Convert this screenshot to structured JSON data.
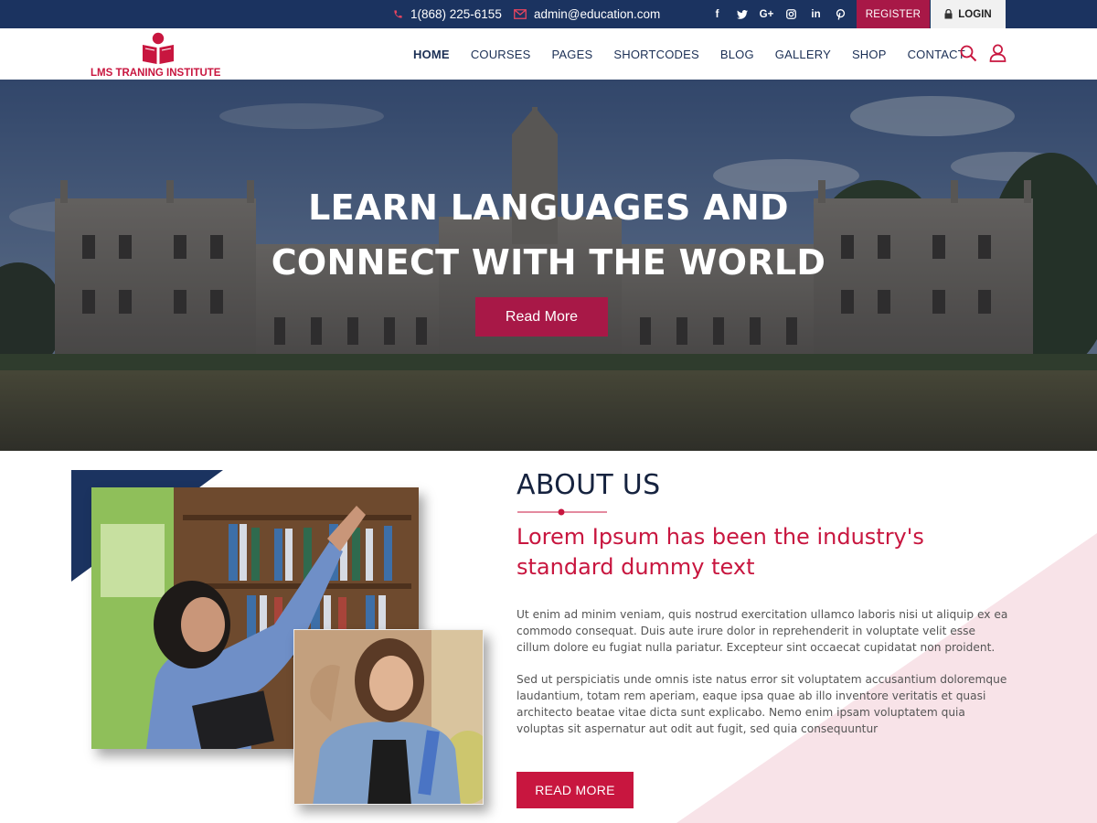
{
  "topbar": {
    "phone": "1(868) 225-6155",
    "email": "admin@education.com",
    "social": [
      {
        "icon": "facebook-icon",
        "glyph": "f"
      },
      {
        "icon": "twitter-icon",
        "glyph": "t"
      },
      {
        "icon": "google-plus-icon",
        "glyph": "G+"
      },
      {
        "icon": "instagram-icon",
        "glyph": "ig"
      },
      {
        "icon": "linkedin-icon",
        "glyph": "in"
      },
      {
        "icon": "pinterest-icon",
        "glyph": "p"
      }
    ],
    "register_label": "REGISTER",
    "login_label": "LOGIN"
  },
  "header": {
    "logo_text": "LMS TRANING INSTITUTE",
    "nav": [
      "HOME",
      "COURSES",
      "PAGES",
      "SHORTCODES",
      "BLOG",
      "GALLERY",
      "SHOP",
      "CONTACT"
    ],
    "active_nav": "HOME"
  },
  "hero": {
    "title_line1": "LEARN LANGUAGES AND",
    "title_line2": "CONNECT WITH THE WORLD",
    "button_label": "Read More"
  },
  "about": {
    "title": "ABOUT US",
    "subtitle": "Lorem Ipsum has been the industry's standard dummy text",
    "paragraph1": "Ut enim ad minim veniam, quis nostrud exercitation ullamco laboris nisi ut aliquip ex ea commodo consequat. Duis aute irure dolor in reprehenderit in voluptate velit esse cillum dolore eu fugiat nulla pariatur. Excepteur sint occaecat cupidatat non proident.",
    "paragraph2": "Sed ut perspiciatis unde omnis iste natus error sit voluptatem accusantium doloremque laudantium, totam rem aperiam, eaque ipsa quae ab illo inventore veritatis et quasi architecto beatae vitae dicta sunt explicabo. Nemo enim ipsam voluptatem quia voluptas sit aspernatur aut odit aut fugit, sed quia consequuntur",
    "button_label": "READ MORE"
  },
  "colors": {
    "topbar_bg": "#1b3360",
    "accent": "#c8163f",
    "accent_dark": "#a81847",
    "heading": "#16233f",
    "pink_triangle": "#f8e3e8"
  }
}
